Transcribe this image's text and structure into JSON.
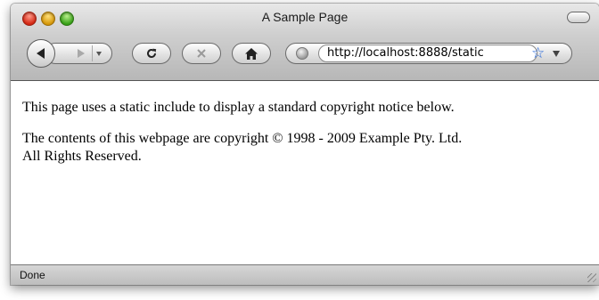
{
  "window": {
    "title": "A Sample Page"
  },
  "toolbar": {
    "icons": {
      "back": "back-arrow-icon",
      "forward": "forward-arrow-icon",
      "reload": "reload-icon",
      "stop": "stop-icon",
      "home": "home-icon",
      "site": "site-globe-icon",
      "bookmark": "star-icon"
    }
  },
  "address_bar": {
    "url": "http://localhost:8888/static"
  },
  "content": {
    "paragraph1": "This page uses a static include to display a standard copyright notice below.",
    "paragraph2_line1": "The contents of this webpage are copyright © 1998 - 2009 Example Pty. Ltd.",
    "paragraph2_line2": "All Rights Reserved."
  },
  "status_bar": {
    "text": "Done"
  },
  "colors": {
    "close": "#d62a16",
    "minimize": "#d89a0c",
    "zoom": "#3aa31a",
    "star": "#2a6ad9"
  }
}
